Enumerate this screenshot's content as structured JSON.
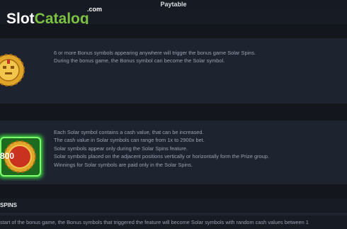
{
  "header": {
    "title": "Paytable"
  },
  "watermark": {
    "brand_first": "Slot",
    "brand_second": "Catalog",
    "brand_suffix": ".com"
  },
  "symbols": [
    {
      "name": "bonus-symbol",
      "lines": [
        "6 or more Bonus symbols appearing anywhere will trigger the bonus game Solar Spins.",
        "During the bonus game, the Bonus symbol can become the Solar symbol."
      ]
    },
    {
      "name": "solar-symbol",
      "value_label": "800",
      "lines": [
        "Each Solar symbol contains a cash value, that can be increased.",
        "The cash value in Solar symbols can range from 1x to 2900x bet.",
        "Solar symbols appear only during the Solar Spins feature.",
        "Solar symbols placed on the adjacent positions vertically or horizontally form the Prize group.",
        "Winnings for Solar symbols are paid only in the Solar Spins."
      ]
    }
  ],
  "section": {
    "title": "SPINS"
  },
  "bottom": {
    "text": "start of the bonus game, the Bonus symbols that triggered the feature will become Solar symbols with random cash values between 1"
  },
  "colors": {
    "background": "#171b24",
    "band": "#1e2330",
    "gold": "#e0a62a",
    "green_glow": "#3ee03e",
    "red": "#c8321e"
  }
}
